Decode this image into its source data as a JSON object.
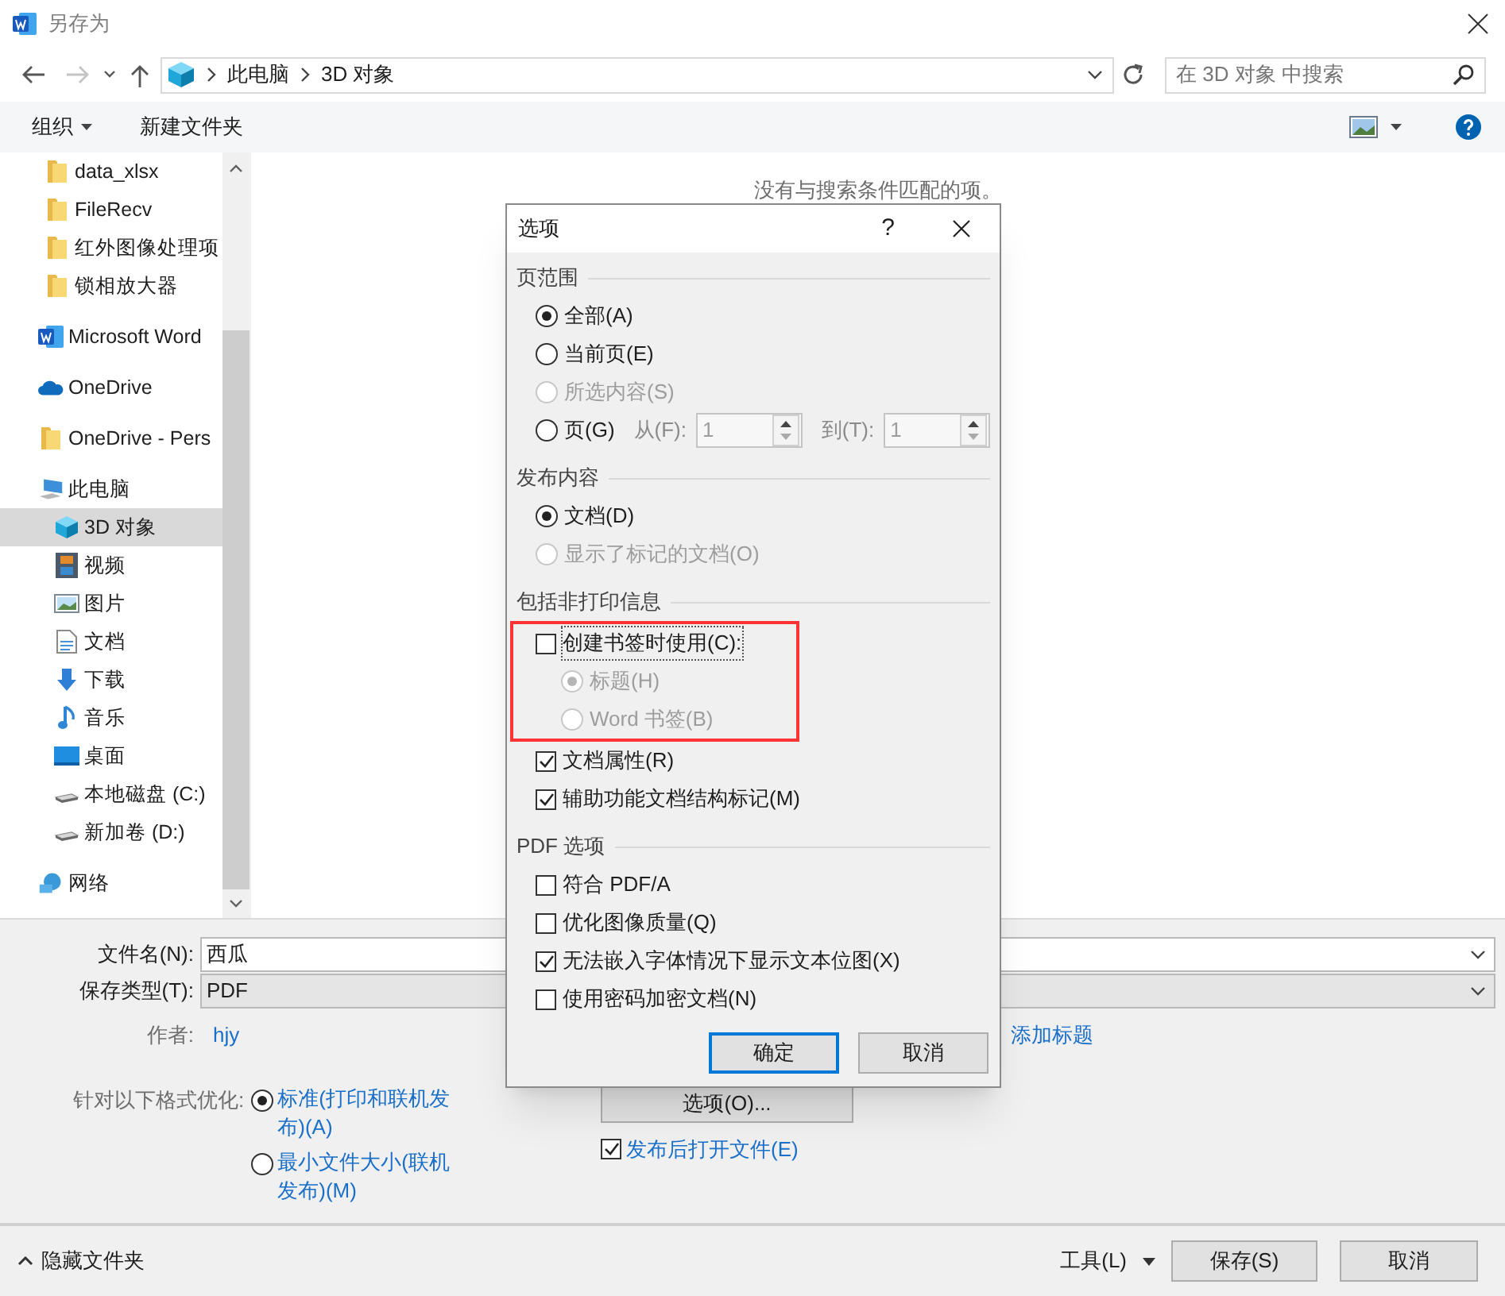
{
  "window": {
    "title": "另存为"
  },
  "nav": {
    "path": [
      "此电脑",
      "3D 对象"
    ],
    "search_placeholder": "在 3D 对象 中搜索"
  },
  "toolbar": {
    "organize": "组织",
    "new_folder": "新建文件夹"
  },
  "sidebar": {
    "pinned_folders": [
      {
        "label": "data_xlsx",
        "kind": "folder",
        "selected": false
      },
      {
        "label": "FileRecv",
        "kind": "folder",
        "selected": false
      },
      {
        "label": "红外图像处理项",
        "kind": "folder",
        "selected": false
      },
      {
        "label": "锁相放大器",
        "kind": "folder",
        "selected": false
      }
    ],
    "items": [
      {
        "label": "Microsoft Word",
        "kind": "word",
        "selected": false
      },
      {
        "label": "OneDrive",
        "kind": "cloud",
        "selected": false
      },
      {
        "label": "OneDrive - Pers",
        "kind": "folder",
        "selected": false
      },
      {
        "label": "此电脑",
        "kind": "pc",
        "selected": false,
        "children": [
          {
            "label": "3D 对象",
            "kind": "cube",
            "selected": true
          },
          {
            "label": "视频",
            "kind": "film",
            "selected": false
          },
          {
            "label": "图片",
            "kind": "image",
            "selected": false
          },
          {
            "label": "文档",
            "kind": "doc",
            "selected": false
          },
          {
            "label": "下载",
            "kind": "download",
            "selected": false
          },
          {
            "label": "音乐",
            "kind": "music",
            "selected": false
          },
          {
            "label": "桌面",
            "kind": "desktop",
            "selected": false
          },
          {
            "label": "本地磁盘 (C:)",
            "kind": "drive",
            "selected": false
          },
          {
            "label": "新加卷 (D:)",
            "kind": "drive",
            "selected": false
          }
        ]
      },
      {
        "label": "网络",
        "kind": "network",
        "selected": false
      }
    ]
  },
  "empty_message": "没有与搜索条件匹配的项。",
  "form": {
    "file_name": {
      "label": "文件名(N):",
      "value": "西瓜"
    },
    "file_type": {
      "label": "保存类型(T):",
      "value": "PDF"
    },
    "author": {
      "label": "作者:",
      "value": "hjy"
    },
    "title_placeholder": "添加标题"
  },
  "optimize": {
    "label": "针对以下格式优化:",
    "options": [
      {
        "label": "标准(打印和联机发布)(A)",
        "selected": true
      },
      {
        "label": "最小文件大小(联机发布)(M)",
        "selected": false
      }
    ]
  },
  "options_button": "选项(O)...",
  "open_after": {
    "label": "发布后打开文件(E)",
    "checked": true
  },
  "footer": {
    "hide_folders": "隐藏文件夹",
    "tools": "工具(L)",
    "save": "保存(S)",
    "cancel": "取消"
  },
  "options_dialog": {
    "title": "选项",
    "help": "?",
    "sections": [
      {
        "heading": "页范围",
        "items": [
          {
            "kind": "radio",
            "label": "全部(A)",
            "selected": true,
            "disabled": false
          },
          {
            "kind": "radio",
            "label": "当前页(E)",
            "selected": false,
            "disabled": false
          },
          {
            "kind": "radio",
            "label": "所选内容(S)",
            "selected": false,
            "disabled": true
          },
          {
            "kind": "range",
            "label": "页(G)",
            "selected": false,
            "disabled": false,
            "from_label": "从(F):",
            "from_value": "1",
            "to_label": "到(T):",
            "to_value": "1",
            "fields_disabled": true
          }
        ]
      },
      {
        "heading": "发布内容",
        "items": [
          {
            "kind": "radio",
            "label": "文档(D)",
            "selected": true,
            "disabled": false
          },
          {
            "kind": "radio",
            "label": "显示了标记的文档(O)",
            "selected": false,
            "disabled": true
          }
        ]
      },
      {
        "heading": "包括非打印信息",
        "items": [
          {
            "kind": "checkbox",
            "label": "创建书签时使用(C):",
            "checked": false,
            "disabled": false,
            "focused": true,
            "highlighted": true,
            "children": [
              {
                "kind": "radio",
                "label": "标题(H)",
                "selected": true,
                "disabled": true
              },
              {
                "kind": "radio",
                "label": "Word 书签(B)",
                "selected": false,
                "disabled": true
              }
            ]
          },
          {
            "kind": "checkbox",
            "label": "文档属性(R)",
            "checked": true,
            "disabled": false,
            "focused": false,
            "highlighted": false
          },
          {
            "kind": "checkbox",
            "label": "辅助功能文档结构标记(M)",
            "checked": true,
            "disabled": false,
            "focused": false,
            "highlighted": false
          }
        ]
      },
      {
        "heading": "PDF 选项",
        "items": [
          {
            "kind": "checkbox",
            "label": "符合 PDF/A",
            "checked": false,
            "disabled": false
          },
          {
            "kind": "checkbox",
            "label": "优化图像质量(Q)",
            "checked": false,
            "disabled": false
          },
          {
            "kind": "checkbox",
            "label": "无法嵌入字体情况下显示文本位图(X)",
            "checked": true,
            "disabled": false
          },
          {
            "kind": "checkbox",
            "label": "使用密码加密文档(N)",
            "checked": false,
            "disabled": false
          }
        ]
      }
    ],
    "buttons": [
      {
        "label": "确定",
        "default": true
      },
      {
        "label": "取消",
        "default": false
      }
    ]
  }
}
